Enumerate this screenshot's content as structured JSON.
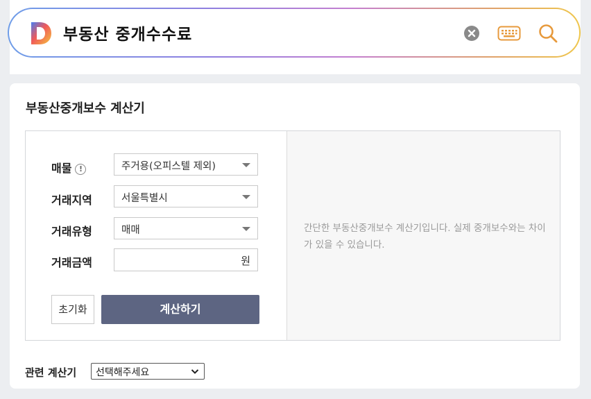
{
  "search": {
    "query": "부동산 중개수수료",
    "logo_icon": "daum-d-logo-icon",
    "clear_icon": "clear-icon",
    "keyboard_icon": "keyboard-icon",
    "search_icon": "search-icon"
  },
  "calculator": {
    "title": "부동산중개보수 계산기",
    "fields": [
      {
        "label": "매물",
        "value": "주거용(오피스텔 제외)",
        "has_info": true
      },
      {
        "label": "거래지역",
        "value": "서울특별시"
      },
      {
        "label": "거래유형",
        "value": "매매"
      },
      {
        "label": "거래금액",
        "value": "",
        "unit": "원"
      }
    ],
    "info_symbol": "!",
    "reset_label": "초기화",
    "calculate_label": "계산하기",
    "notice": "간단한 부동산중개보수 계산기입니다. 실제 중개보수와는 차이가 있을 수 있습니다."
  },
  "related": {
    "label": "관련 계산기",
    "selected": "선택해주세요"
  },
  "colors": {
    "accent_button": "#5d6582",
    "search_gradient_start": "#6f9de8",
    "search_gradient_end": "#efc64c",
    "icon_orange": "#e79a3c"
  }
}
